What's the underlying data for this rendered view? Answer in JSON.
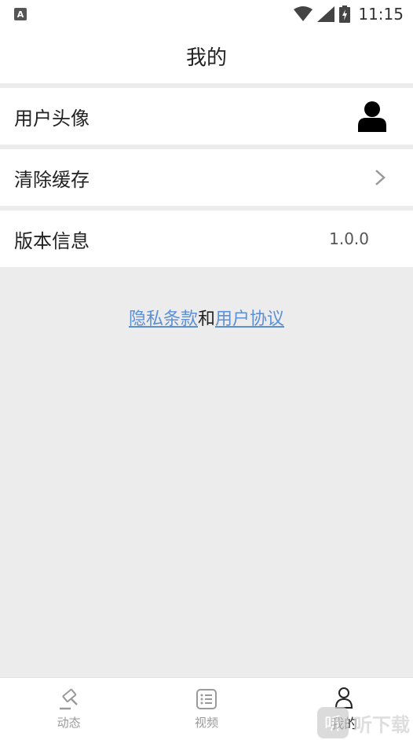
{
  "status_bar": {
    "badge": "A",
    "time": "11:15"
  },
  "header": {
    "title": "我的"
  },
  "rows": [
    {
      "label": "用户头像",
      "icon": "person-avatar-icon"
    },
    {
      "label": "清除缓存",
      "icon": "chevron-right-icon"
    },
    {
      "label": "版本信息",
      "value": "1.0.0"
    }
  ],
  "links": {
    "privacy": "隐私条款",
    "and": "和",
    "agreement": "用户协议",
    "link_color": "#5b8fd6"
  },
  "tabs": [
    {
      "label": "动态",
      "icon": "hammer-icon",
      "active": false
    },
    {
      "label": "视频",
      "icon": "list-icon",
      "active": false
    },
    {
      "label": "我的",
      "icon": "person-outline-icon",
      "active": true
    }
  ],
  "watermark": {
    "logo": "听",
    "text": "听下载"
  }
}
